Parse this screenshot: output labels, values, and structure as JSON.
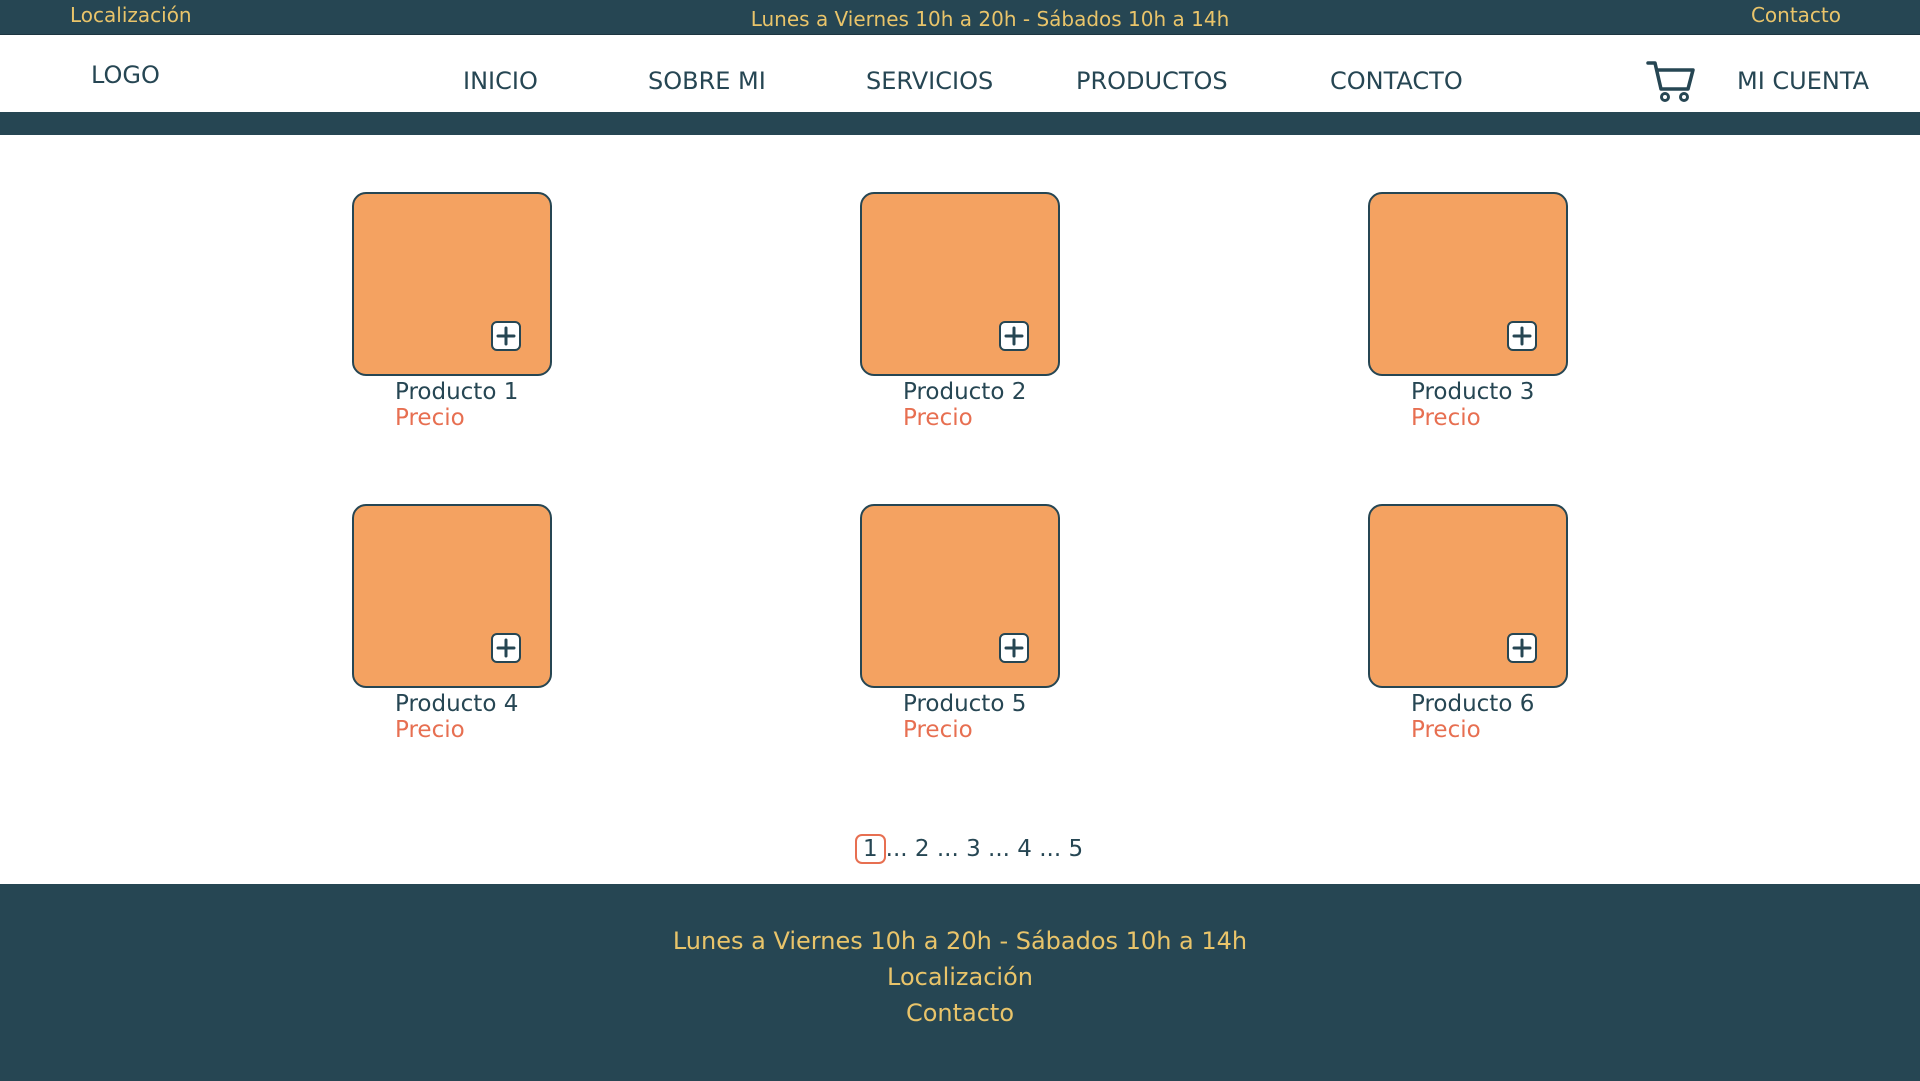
{
  "topbar": {
    "location": "Localización",
    "hours": "Lunes a Viernes 10h a 20h - Sábados 10h a 14h",
    "contact": "Contacto"
  },
  "navbar": {
    "logo": "LOGO",
    "items": [
      "INICIO",
      "SOBRE MI",
      "SERVICIOS",
      "PRODUCTOS",
      "CONTACTO"
    ],
    "cart_icon": "shopping-cart-icon",
    "account": "MI CUENTA"
  },
  "products": [
    {
      "name": "Producto 1",
      "price": "Precio"
    },
    {
      "name": "Producto 2",
      "price": "Precio"
    },
    {
      "name": "Producto 3",
      "price": "Precio"
    },
    {
      "name": "Producto 4",
      "price": "Precio"
    },
    {
      "name": "Producto 5",
      "price": "Precio"
    },
    {
      "name": "Producto 6",
      "price": "Precio"
    }
  ],
  "pagination": {
    "current": "1",
    "separator": "...",
    "pages": [
      "2",
      "3",
      "4",
      "5"
    ]
  },
  "footer": {
    "hours": "Lunes a Viernes 10h a 20h - Sábados 10h a 14h",
    "location": "Localización",
    "contact": "Contacto"
  },
  "colors": {
    "primary": "#264653",
    "accent_yellow": "#e9c46a",
    "product_fill": "#f4a261",
    "price": "#e76f51"
  }
}
